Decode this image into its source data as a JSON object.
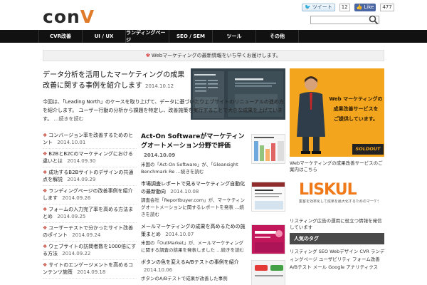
{
  "site": {
    "logo_text": "con",
    "logo_accent": "V",
    "accent_color": "#e07b2a"
  },
  "social": {
    "tweet_label": "ツイート",
    "tweet_count": "12",
    "like_label": "Like",
    "like_count": "477"
  },
  "search": {
    "placeholder": ""
  },
  "nav": [
    "CVR改善",
    "UI / UX",
    "ランディングページ",
    "SEO / SEM",
    "ツール",
    "その他"
  ],
  "notice": "Webマーケティングの最新情報をいち早くお届けします。",
  "feature": {
    "title": "データ分析を活用したマーケティングの成果改善に関する事例を紹介します",
    "date": "2014.10.12",
    "excerpt": "今回は、「Leading North」のケースを取り上げて、データに基づいたウェブサイトのリニューアルの進め方を紹介します。 ユーザー行動の分析から課題を特定し、改善施策を実行することで大きな成果を上げています。",
    "readmore": "…続きを読む"
  },
  "left_list": [
    {
      "title": "コンバージョン率を改善するためのヒント",
      "date": "2014.10.01"
    },
    {
      "title": "B2BとB2Cのマーケティングにおける違いとは",
      "date": "2014.09.30"
    },
    {
      "title": "成功するB2Bサイトのデザインの共通点を解説",
      "date": "2014.09.29"
    },
    {
      "title": "ランディングページの改善事例を紹介します",
      "date": "2014.09.26"
    },
    {
      "title": "フォームの入力完了率を高める方法まとめ",
      "date": "2014.09.25"
    },
    {
      "title": "ユーザーテストで分かったサイト改善のポイント",
      "date": "2014.09.24"
    },
    {
      "title": "ウェブサイトの訪問者数を1000倍にする方法",
      "date": "2014.09.22"
    },
    {
      "title": "サイトのエンゲージメントを高めるコンテンツ施策",
      "date": "2014.09.18"
    }
  ],
  "mid_list": [
    {
      "title": "Act-On Softwareがマーケティングオートメーション分野で評価",
      "date": "2014.10.09",
      "excerpt": "米国の「Act-On Software」が、「Gleansight Benchmark Re …続きを読む"
    },
    {
      "title": "市場調査レポートで見るマーケティング自動化の最新動向",
      "date": "2014.10.08",
      "excerpt": "調査会社「Reportbuyer.com」が、マーケティングオートメーションに関するレポートを発表 …続きを読む"
    },
    {
      "title": "メールマーケティングの成果を高めるための施策まとめ",
      "date": "2014.10.07",
      "excerpt": "米国の「OutMarket」が、メールマーケティングに関する調査の結果を発表しました …続きを読む"
    },
    {
      "title": "ボタンの色を変えるA/Bテストの事例を紹介",
      "date": "2014.10.06",
      "excerpt": "ボタンのA/Bテストで成果が改善した事例"
    }
  ],
  "ad": {
    "line1": "Web マーケティングの",
    "line2": "成果改善サービスを",
    "line3": "ご提供しています。",
    "brand": "SOLDOUT",
    "caption": "Webマーケティングの成果改善サービスのご案内はこちら"
  },
  "liskul": {
    "logo": "LISKUL",
    "tagline": "集客を効率化して成果を最大化するためのマーケティング情報",
    "caption": "リスティング広告の運用に役立つ情報を発信しています"
  },
  "sidebar": {
    "section_title": "人気のタグ",
    "tags": "リスティング SEO Webデザイン CVR ランディングページ ユーザビリティ フォーム改善 A/Bテスト メール Google アナリティクス"
  }
}
